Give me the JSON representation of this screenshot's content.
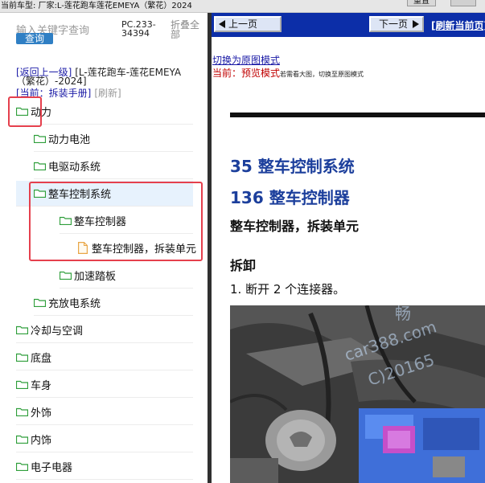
{
  "topbar": {
    "car_info": "当前车型:  厂家:L-莲花跑车莲花EMEYA（繁花）2024",
    "tab_label": "重置"
  },
  "sidebar": {
    "search_placeholder": "输入关键字查询",
    "search_button": "查询",
    "pc_number": "PC.233-34394",
    "collapse_all": "折叠全部",
    "back_link": "[返回上一级]",
    "vehicle_path": "[L-莲花跑车-莲花EMEYA（繁花）-2024]",
    "current_label": "[当前：拆装手册]",
    "refresh": "[刷新]",
    "tree": [
      {
        "label": "动力",
        "type": "folder"
      },
      {
        "label": "动力电池",
        "type": "folder"
      },
      {
        "label": "电驱动系统",
        "type": "folder"
      },
      {
        "label": "整车控制系统",
        "type": "folder"
      },
      {
        "label": "整车控制器",
        "type": "folder"
      },
      {
        "label": "整车控制器，拆装单元",
        "type": "document"
      },
      {
        "label": "加速踏板",
        "type": "folder"
      },
      {
        "label": "充放电系统",
        "type": "folder"
      },
      {
        "label": "冷却与空调",
        "type": "folder"
      },
      {
        "label": "底盘",
        "type": "folder"
      },
      {
        "label": "车身",
        "type": "folder"
      },
      {
        "label": "外饰",
        "type": "folder"
      },
      {
        "label": "内饰",
        "type": "folder"
      },
      {
        "label": "电子电器",
        "type": "folder"
      }
    ]
  },
  "content": {
    "prev_page": "上一页",
    "next_page": "下一页",
    "refresh_current": "[刷新当前页]",
    "switch_original": "切换为原图模式",
    "mode_current": "当前：预览模式",
    "mode_desc": "若需看大图，切换至原图模式",
    "heading_1": "35 整车控制系统",
    "heading_2": "136 整车控制器",
    "heading_3": "整车控制器，拆装单元",
    "section": "拆卸",
    "step_1": "1.   断开 2 个连接器。",
    "watermark_1": "畅",
    "watermark_2": "car388.com",
    "watermark_3": "C)20165"
  },
  "colors": {
    "highlight_box": "#e5404d",
    "nav_bar": "#0c2ea8",
    "heading_blue": "#1c3f9c",
    "folder_icon": "#2e9e3a",
    "doc_icon": "#e9a646",
    "search_button": "#2f7fc4"
  }
}
